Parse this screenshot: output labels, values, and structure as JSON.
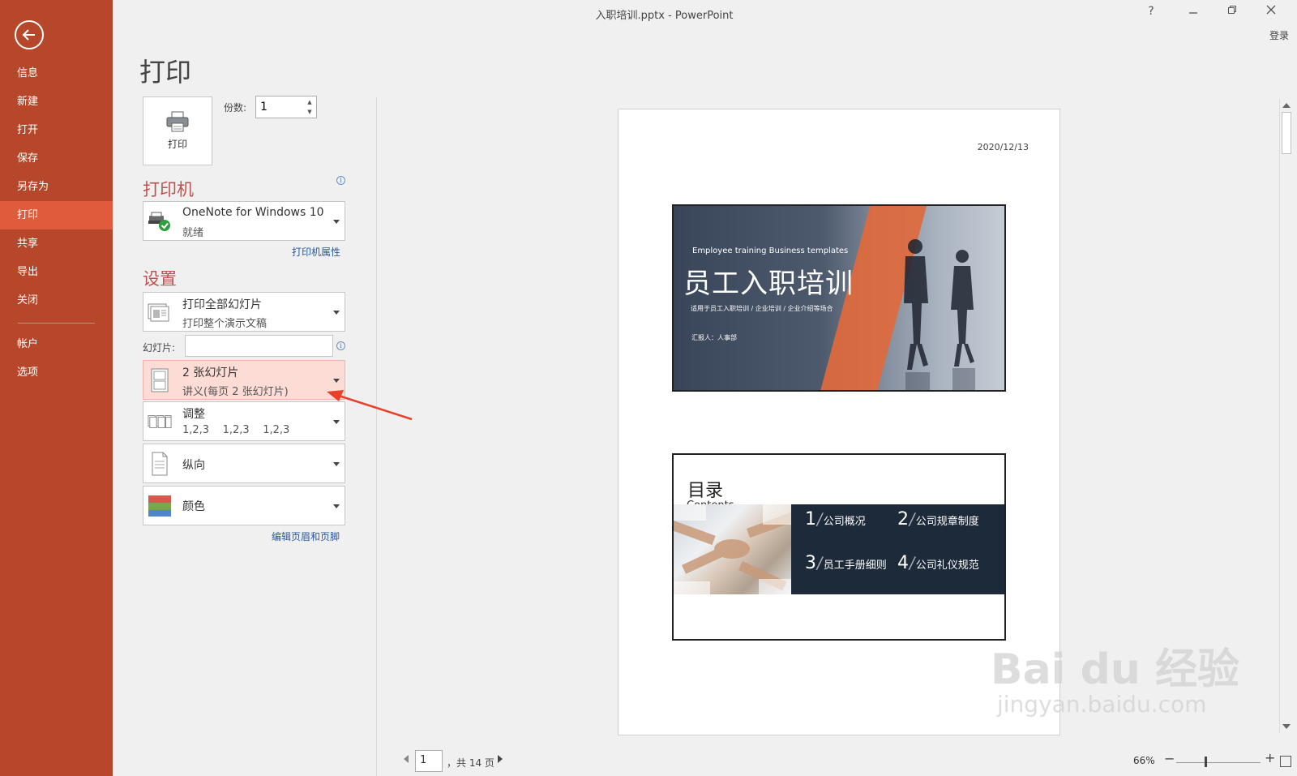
{
  "window": {
    "title": "入职培训.pptx - PowerPoint",
    "help": "?",
    "login": "登录"
  },
  "sidebar": {
    "items": [
      {
        "label": "信息"
      },
      {
        "label": "新建"
      },
      {
        "label": "打开"
      },
      {
        "label": "保存"
      },
      {
        "label": "另存为"
      },
      {
        "label": "打印",
        "active": true
      },
      {
        "label": "共享"
      },
      {
        "label": "导出"
      },
      {
        "label": "关闭"
      }
    ],
    "bottom_items": [
      {
        "label": "帐户"
      },
      {
        "label": "选项"
      }
    ]
  },
  "print": {
    "heading": "打印",
    "button_label": "打印",
    "copies_label": "份数:",
    "copies_value": "1"
  },
  "printer": {
    "section": "打印机",
    "name": "OneNote for Windows 10",
    "status": "就绪",
    "properties_link": "打印机属性"
  },
  "settings": {
    "section": "设置",
    "range_main": "打印全部幻灯片",
    "range_sub": "打印整个演示文稿",
    "slides_label": "幻灯片:",
    "slides_value": "",
    "layout_main": "2 张幻灯片",
    "layout_sub": "讲义(每页 2 张幻灯片)",
    "collate_main": "调整",
    "collate_sub": "1,2,3    1,2,3    1,2,3",
    "orientation": "纵向",
    "color": "颜色",
    "header_footer_link": "编辑页眉和页脚"
  },
  "preview": {
    "date": "2020/12/13",
    "slide1": {
      "en_title": "Employee training Business templates",
      "cn_title": "员工入职培训",
      "desc": "适用于员工入职培训 / 企业培训 / 企业介绍等场合",
      "reporter": "汇报人：人事部"
    },
    "slide2": {
      "title": "目录",
      "subtitle": "Contents",
      "items": [
        {
          "num": "1",
          "label": "公司概况"
        },
        {
          "num": "2",
          "label": "公司规章制度"
        },
        {
          "num": "3",
          "label": "员工手册细则"
        },
        {
          "num": "4",
          "label": "公司礼仪规范"
        }
      ]
    }
  },
  "pagination": {
    "current": "1",
    "total_text": "，共 14 页"
  },
  "zoom": {
    "value": "66%",
    "minus": "−",
    "plus": "+"
  },
  "watermark": {
    "main": "Bai du 经验",
    "sub": "jingyan.baidu.com"
  },
  "colors": {
    "sidebar": "#b7472a",
    "sidebar_active": "#e05a3c",
    "section_title": "#c0504d",
    "link": "#2b579a",
    "highlight": "#fcdcd5",
    "annotation_arrow": "#e8402a"
  }
}
